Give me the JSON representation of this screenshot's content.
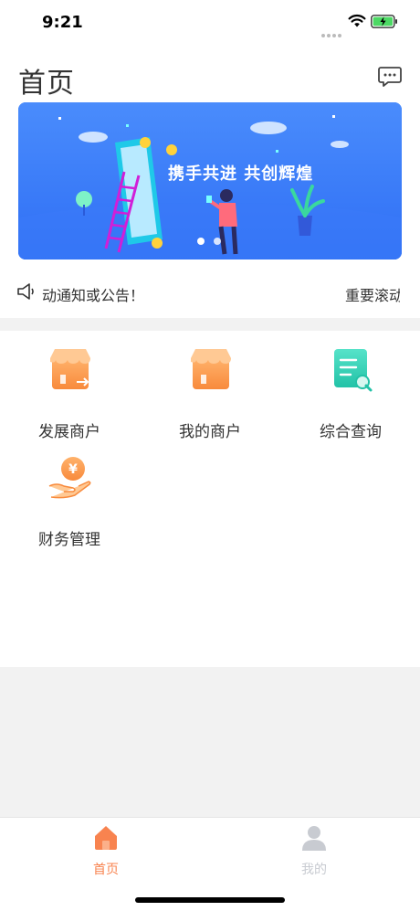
{
  "status_bar": {
    "time": "9:21"
  },
  "header": {
    "title": "首页",
    "message_icon": "chat-bubble-icon"
  },
  "banner": {
    "slogan": "携手共进 共创辉煌",
    "slide_count": 2,
    "active_slide": 1
  },
  "notice": {
    "text": "动通知或公告！",
    "text_2": "重要滚动"
  },
  "menu": [
    {
      "label": "发展商户",
      "icon": "store-arrow-icon"
    },
    {
      "label": "我的商户",
      "icon": "store-icon"
    },
    {
      "label": "综合查询",
      "icon": "document-search-icon"
    },
    {
      "label": "财务管理",
      "icon": "finance-yuan-icon"
    }
  ],
  "tabs": [
    {
      "label": "首页",
      "icon": "home-icon",
      "active": true
    },
    {
      "label": "我的",
      "icon": "user-icon",
      "active": false
    }
  ],
  "colors": {
    "accent": "#f8834f",
    "banner_bg": "#3f82fb",
    "inactive_tab": "#c8cbd1",
    "teal": "#2fd3b8"
  }
}
